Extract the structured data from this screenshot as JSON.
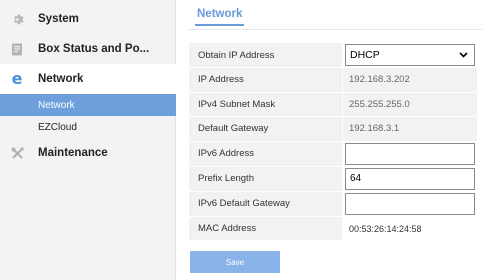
{
  "sidebar": {
    "items": [
      {
        "label": "System",
        "icon": "gear-icon"
      },
      {
        "label": "Box Status and Po...",
        "icon": "document-icon"
      },
      {
        "label": "Network",
        "icon": "internet-e-icon",
        "active": true
      },
      {
        "label": "Maintenance",
        "icon": "tools-icon"
      }
    ],
    "subitems": [
      {
        "label": "Network",
        "active": true
      },
      {
        "label": "EZCloud",
        "active": false
      }
    ]
  },
  "main": {
    "tab": "Network",
    "fields": [
      {
        "label": "Obtain IP Address",
        "value": "DHCP",
        "kind": "select"
      },
      {
        "label": "IP Address",
        "value": "192.168.3.202",
        "kind": "readonly"
      },
      {
        "label": "IPv4 Subnet Mask",
        "value": "255.255.255.0",
        "kind": "readonly"
      },
      {
        "label": "Default Gateway",
        "value": "192.168.3.1",
        "kind": "readonly"
      },
      {
        "label": "IPv6 Address",
        "value": "",
        "kind": "input"
      },
      {
        "label": "Prefix Length",
        "value": "64",
        "kind": "input"
      },
      {
        "label": "IPv6 Default Gateway",
        "value": "",
        "kind": "input"
      },
      {
        "label": "MAC Address",
        "value": "00:53:26:14:24:58",
        "kind": "plain"
      }
    ],
    "save_label": "Save"
  },
  "colors": {
    "accent": "#6a9ad8",
    "active_subitem_bg": "#6c9fdc",
    "save_button_bg": "#89b3e9",
    "network_icon": "#4a8fd8"
  }
}
